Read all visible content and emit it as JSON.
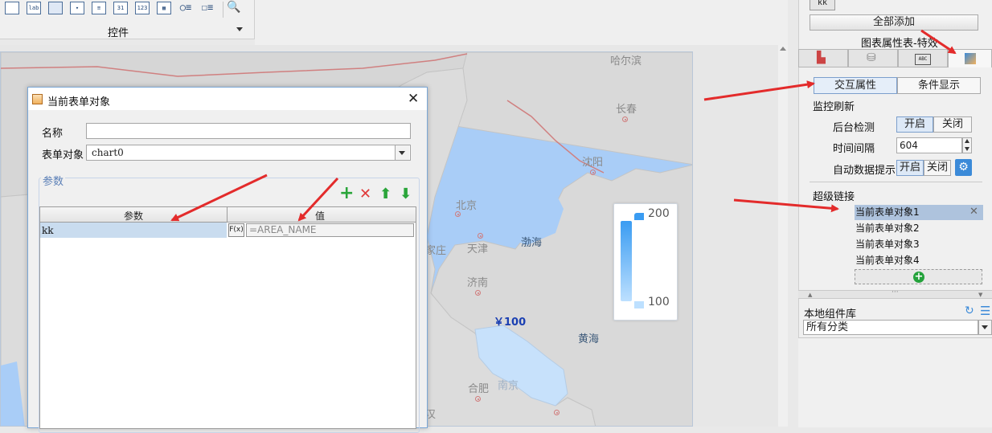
{
  "toolbar": {
    "label": "控件",
    "icons": [
      "lab",
      "31",
      "123"
    ]
  },
  "map": {
    "cities": [
      {
        "name": "哈尔滨"
      },
      {
        "name": "长春"
      },
      {
        "name": "沈阳"
      },
      {
        "name": "北京"
      },
      {
        "name": "天津"
      },
      {
        "name": "家庄"
      },
      {
        "name": "济南"
      },
      {
        "name": "合肥"
      },
      {
        "name": "南京"
      },
      {
        "name": "汉"
      }
    ],
    "seas": [
      "渤海",
      "黄海"
    ],
    "price_label": "￥100",
    "legend": {
      "max": "200",
      "min": "100"
    },
    "colors": {
      "sea": "#a9cdf7",
      "land": "#d9d9d9",
      "highlight": "#c7e1fb"
    }
  },
  "dialog": {
    "title": "当前表单对象",
    "name_label": "名称",
    "name_value": "",
    "object_label": "表单对象",
    "object_value": "chart0",
    "params_legend": "参数",
    "table": {
      "headers": [
        "参数",
        "值"
      ],
      "rows": [
        {
          "key": "kk",
          "fx": "F(x)",
          "value": "=AREA_NAME"
        }
      ]
    }
  },
  "right_panel": {
    "chip": "kk",
    "add_all": "全部添加",
    "title": "图表属性表-特效",
    "subtabs": [
      "交互属性",
      "条件显示"
    ],
    "monitor_title": "监控刷新",
    "backend_label": "后台检测",
    "on_label": "开启",
    "off_label": "关闭",
    "interval_label": "时间间隔",
    "interval_value": "604",
    "autotip_label": "自动数据提示",
    "hyperlink_title": "超级链接",
    "hyperlinks": [
      "当前表单对象1",
      "当前表单对象2",
      "当前表单对象3",
      "当前表单对象4"
    ],
    "library_title": "本地组件库",
    "library_select": "所有分类"
  }
}
